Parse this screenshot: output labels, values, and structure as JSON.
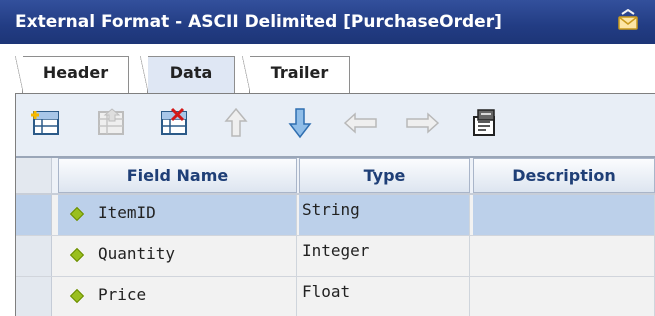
{
  "window": {
    "title": "External Format - ASCII Delimited [PurchaseOrder]"
  },
  "tabs": [
    {
      "label": "Header"
    },
    {
      "label": "Data"
    },
    {
      "label": "Trailer"
    }
  ],
  "toolbar": {
    "buttons": [
      {
        "name": "add-row",
        "icon": "table-add-icon"
      },
      {
        "name": "insert-row",
        "icon": "table-insert-icon"
      },
      {
        "name": "delete-row",
        "icon": "table-delete-icon"
      },
      {
        "name": "move-up",
        "icon": "arrow-up-icon"
      },
      {
        "name": "move-down",
        "icon": "arrow-down-icon"
      },
      {
        "name": "move-left",
        "icon": "arrow-left-icon"
      },
      {
        "name": "move-right",
        "icon": "arrow-right-icon"
      },
      {
        "name": "properties",
        "icon": "properties-icon"
      }
    ]
  },
  "grid": {
    "columns": [
      "Field Name",
      "Type",
      "Description"
    ],
    "rows": [
      {
        "name": "ItemID",
        "type": "String",
        "description": ""
      },
      {
        "name": "Quantity",
        "type": "Integer",
        "description": ""
      },
      {
        "name": "Price",
        "type": "Float",
        "description": ""
      }
    ]
  },
  "colors": {
    "title_bg": "#223c83",
    "selected_row": "#bcd0ea",
    "header_text": "#1f3f77"
  }
}
